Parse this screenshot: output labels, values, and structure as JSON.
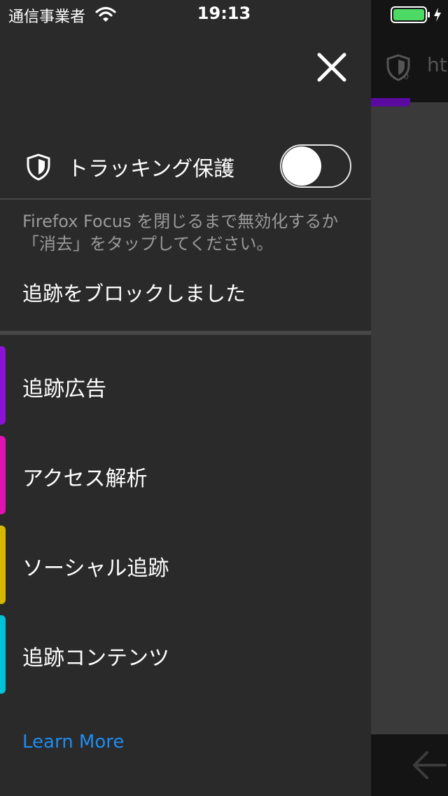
{
  "status_bar": {
    "carrier": "通信事業者",
    "time": "19:13"
  },
  "background_browser": {
    "url_fragment": "ht"
  },
  "drawer": {
    "tracking_protection_label": "トラッキング保護",
    "tracking_protection_enabled": false,
    "description": "Firefox Focus を閉じるまで無効化するか「消去」をタップしてください。",
    "blocked_status": "追跡をブロックしました",
    "categories": [
      {
        "label": "追跡広告",
        "color": "#8b12d6"
      },
      {
        "label": "アクセス解析",
        "color": "#e012b0"
      },
      {
        "label": "ソーシャル追跡",
        "color": "#d7b600"
      },
      {
        "label": "追跡コンテンツ",
        "color": "#00c2d6"
      }
    ],
    "learn_more": "Learn More"
  },
  "colors": {
    "drawer_background": "#2a2a2a",
    "link": "#1e8cf0",
    "battery": "#4cd964"
  }
}
